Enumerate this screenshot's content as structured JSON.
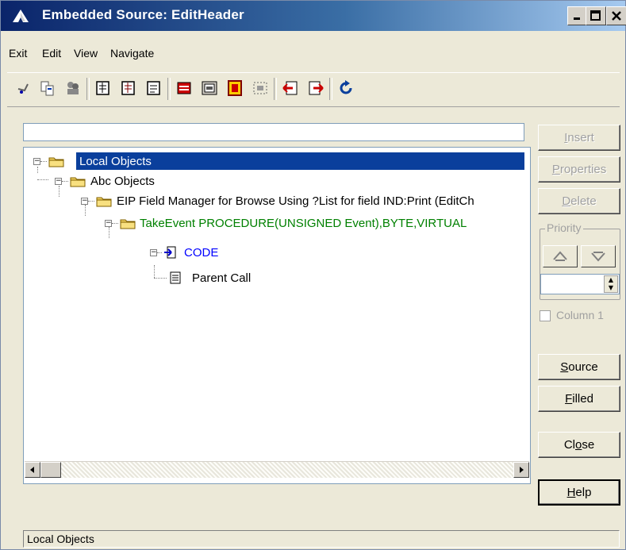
{
  "window": {
    "title": "Embedded Source: EditHeader",
    "controls": [
      "minimize-icon",
      "maximize-icon",
      "close-icon"
    ]
  },
  "menu": [
    "Exit",
    "Edit",
    "View",
    "Navigate"
  ],
  "toolbar": {
    "icons": [
      "pointer-icon",
      "copy-icon",
      "users-icon",
      "embed-icon-1",
      "embed-icon-2",
      "embed-icon-3",
      "red-embed-icon",
      "screen-embed-icon",
      "highlight-embed-icon",
      "dotted-embed-icon",
      "prev-red-icon",
      "next-red-icon",
      "refresh-icon"
    ]
  },
  "search": {
    "value": ""
  },
  "tree": {
    "nodes": [
      {
        "label": "Local Objects",
        "selected": true,
        "color": "#ffffff"
      },
      {
        "label": "Abc Objects",
        "color": "#000000"
      },
      {
        "label": "EIP Field Manager for Browse Using ?List for field IND:Print (EditCh",
        "color": "#000000"
      },
      {
        "label": "TakeEvent PROCEDURE(UNSIGNED Event),BYTE,VIRTUAL",
        "color": "#008000"
      },
      {
        "label": "CODE",
        "color": "#0000ff"
      },
      {
        "label": "Parent Call",
        "color": "#000000"
      }
    ]
  },
  "buttons": {
    "insert": {
      "pre": "",
      "u": "I",
      "post": "nsert"
    },
    "properties": {
      "pre": "",
      "u": "P",
      "post": "roperties"
    },
    "delete": {
      "pre": "",
      "u": "D",
      "post": "elete"
    },
    "source": {
      "pre": "",
      "u": "S",
      "post": "ource"
    },
    "filled": {
      "pre": "",
      "u": "F",
      "post": "illed"
    },
    "close": {
      "pre": "Cl",
      "u": "o",
      "post": "se"
    },
    "help": {
      "pre": "",
      "u": "H",
      "post": "elp"
    }
  },
  "priority": {
    "label": "Priority",
    "value": ""
  },
  "column_checkbox": {
    "label": "Column 1",
    "checked": false
  },
  "status": {
    "text": "Local Objects"
  },
  "colors": {
    "title_start": "#0a246a",
    "title_end": "#a6caf0",
    "selection": "#0a3f9c"
  }
}
